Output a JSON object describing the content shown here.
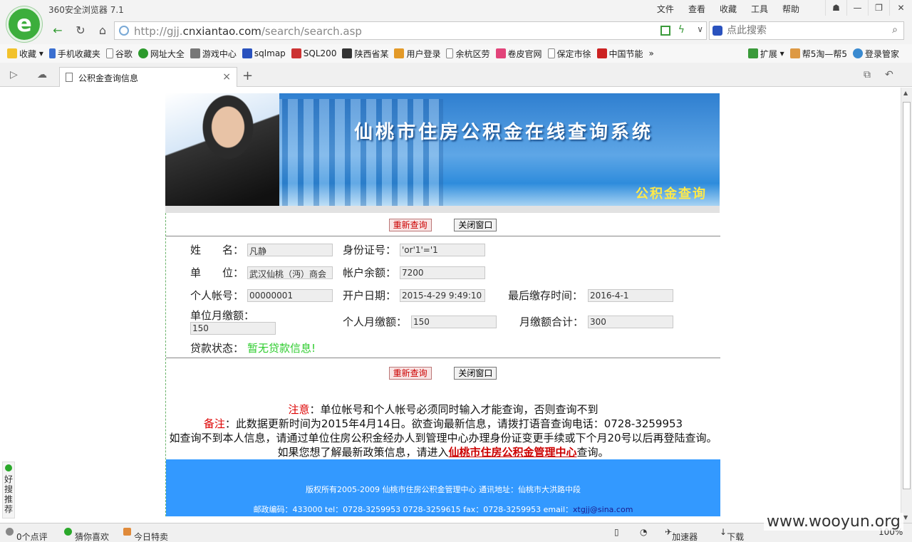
{
  "browser": {
    "app_name": "360安全浏览器 7.1",
    "menus": [
      "文件",
      "查看",
      "收藏",
      "工具",
      "帮助"
    ],
    "url_prefix": "http://gjj.",
    "url_domain": "cnxiantao.com",
    "url_path": "/search/search.asp",
    "search_placeholder": "点此搜索",
    "bookmarks": [
      "收藏",
      "手机收藏夹",
      "谷歌",
      "网址大全",
      "游戏中心",
      "sqlmap",
      "SQL200",
      "陕西省某",
      "用户登录",
      "余杭区劳",
      "卷皮官网",
      "保定市徐",
      "中国节能"
    ],
    "bookmarks_right": [
      "扩展",
      "帮5淘—帮5",
      "登录管家"
    ],
    "tab_title": "公积金查询信息"
  },
  "page": {
    "banner_title": "仙桃市住房公积金在线查询系统",
    "banner_sub": "公积金查询",
    "btn_requery": "重新查询",
    "btn_close": "关闭窗口",
    "labels": {
      "name": "姓　　名：",
      "idcard": "身份证号：",
      "unit": "单　　位：",
      "balance": "帐户余额：",
      "account": "个人帐号：",
      "open_date": "开户日期：",
      "last_pay": "最后缴存时间：",
      "unit_monthly": "单位月缴额：",
      "personal_monthly": "个人月缴额：",
      "monthly_total": "月缴额合计：",
      "loan_status": "贷款状态："
    },
    "values": {
      "name": "凡静",
      "idcard": "'or'1'='1",
      "unit": "武汉仙桃（沔）商会",
      "balance": "7200",
      "account": "00000001",
      "open_date": "2015-4-29 9:49:10",
      "last_pay": "2016-4-1",
      "unit_monthly": "150",
      "personal_monthly": "150",
      "monthly_total": "300",
      "loan_status": "暂无贷款信息!"
    },
    "notes": {
      "note_label": "注意",
      "note_text": "：单位帐号和个人帐号必须同时输入才能查询，否则查询不到",
      "remark_label": "备注",
      "remark_text": "：此数据更新时间为2015年4月14日。欲查询最新信息，请拨打语音查询电话：0728-3259953",
      "line3": "如查询不到本人信息，请通过单位住房公积金经办人到管理中心办理身份证变更手续或下个月20号以后再登陆查询。",
      "line4_pre": "如果您想了解最新政策信息，请进入",
      "line4_link": "仙桃市住房公积金管理中心",
      "line4_post": "查询。"
    },
    "footer": {
      "line1": "版权所有2005-2009 仙桃市住房公积金管理中心 通讯地址：仙桃市大洪路中段",
      "line2": "邮政编码：433000 tel：0728-3259953 0728-3259615 fax：0728-3259953 email：",
      "email": "xtgjj@sina.com"
    }
  },
  "side_widget": "好搜推荐",
  "status": {
    "comments": "0个点评",
    "guess": "猜你喜欢",
    "deals": "今日特卖",
    "accelerator": "加速器",
    "download": "下载",
    "zoom": "100%"
  },
  "watermark": "www.wooyun.org"
}
